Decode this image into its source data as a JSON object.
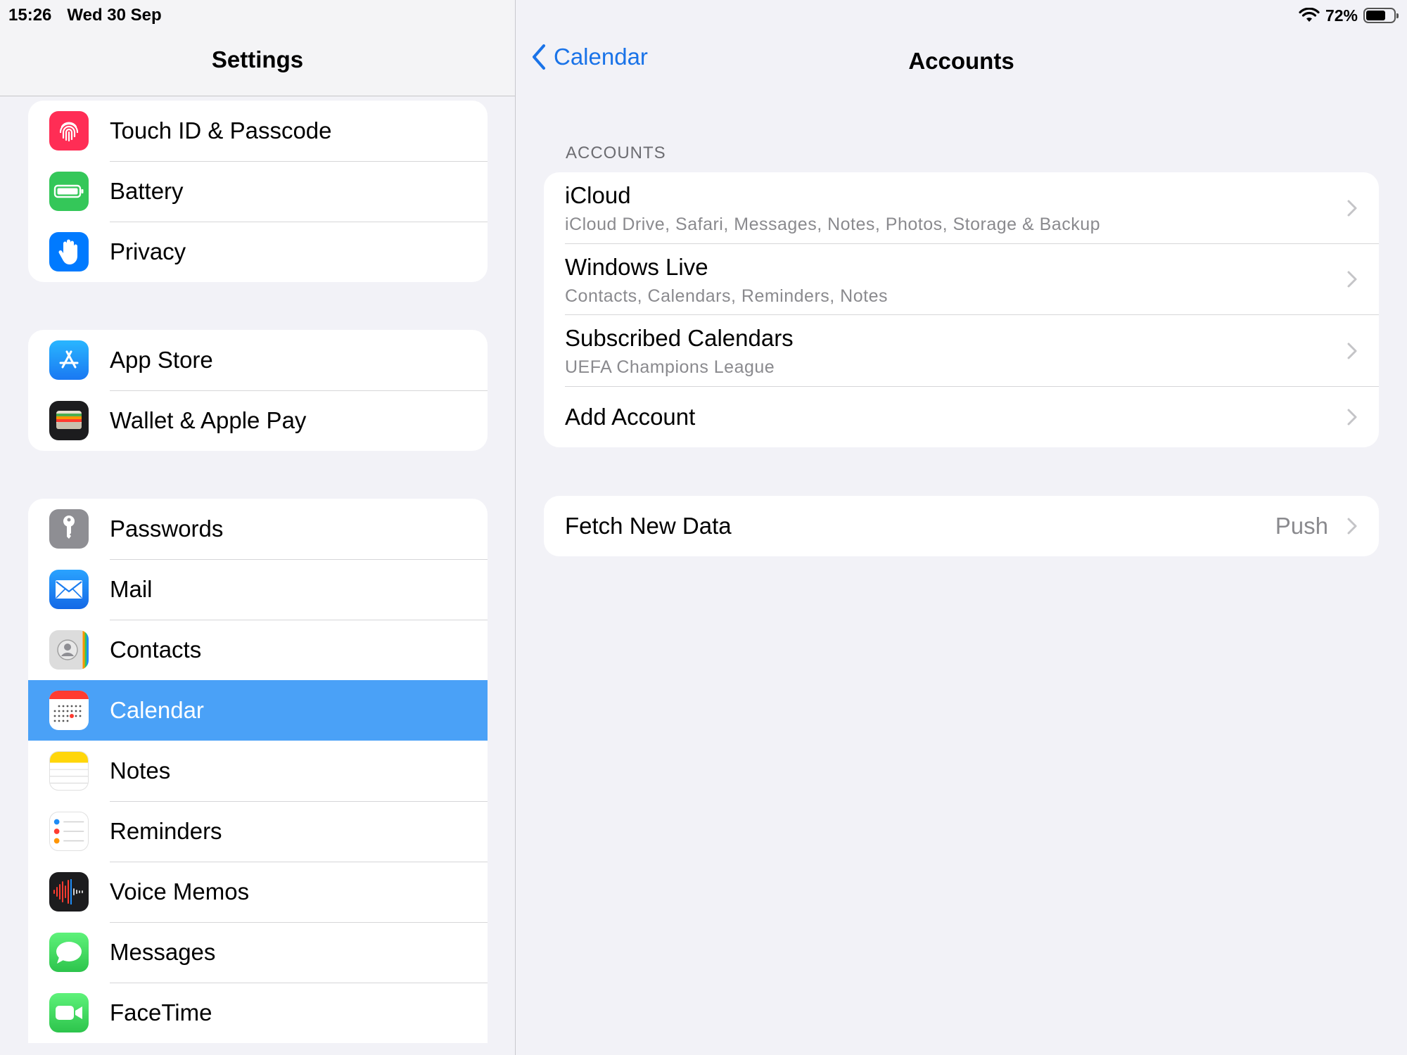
{
  "status_bar": {
    "time": "15:26",
    "date": "Wed 30 Sep",
    "battery_percent": "72%",
    "battery_level": 0.72
  },
  "sidebar": {
    "title": "Settings",
    "groups": [
      {
        "items": [
          {
            "label": "Touch ID & Passcode",
            "icon": "fingerprint-icon",
            "color": "#ff2d55"
          },
          {
            "label": "Battery",
            "icon": "battery-icon",
            "color": "#34c759"
          },
          {
            "label": "Privacy",
            "icon": "hand-icon",
            "color": "#007aff"
          }
        ]
      },
      {
        "items": [
          {
            "label": "App Store",
            "icon": "app-store-icon",
            "color": "#1c8ef9"
          },
          {
            "label": "Wallet & Apple Pay",
            "icon": "wallet-icon",
            "color": "#1c1c1e"
          }
        ]
      },
      {
        "items": [
          {
            "label": "Passwords",
            "icon": "key-icon",
            "color": "#8e8e93"
          },
          {
            "label": "Mail",
            "icon": "mail-icon",
            "color": "#1e8cf5"
          },
          {
            "label": "Contacts",
            "icon": "contacts-icon",
            "color": "#d6d6d6"
          },
          {
            "label": "Calendar",
            "icon": "calendar-icon",
            "color": "#ffffff",
            "selected": true
          },
          {
            "label": "Notes",
            "icon": "notes-icon",
            "color": "#ffffff"
          },
          {
            "label": "Reminders",
            "icon": "reminders-icon",
            "color": "#ffffff"
          },
          {
            "label": "Voice Memos",
            "icon": "voice-memos-icon",
            "color": "#1c1c1e"
          },
          {
            "label": "Messages",
            "icon": "messages-icon",
            "color": "#34c759"
          },
          {
            "label": "FaceTime",
            "icon": "facetime-icon",
            "color": "#34c759"
          }
        ]
      }
    ]
  },
  "detail": {
    "back_label": "Calendar",
    "title": "Accounts",
    "section_header": "ACCOUNTS",
    "accounts": [
      {
        "title": "iCloud",
        "subtitle": "iCloud Drive, Safari, Messages, Notes, Photos, Storage & Backup"
      },
      {
        "title": "Windows Live",
        "subtitle": "Contacts, Calendars, Reminders, Notes"
      },
      {
        "title": "Subscribed Calendars",
        "subtitle": "UEFA Champions League"
      },
      {
        "title": "Add Account"
      }
    ],
    "fetch": {
      "label": "Fetch New Data",
      "value": "Push"
    }
  },
  "colors": {
    "accent": "#1a73e8",
    "selected_row": "#4aa1f7",
    "background": "#f2f2f7"
  }
}
